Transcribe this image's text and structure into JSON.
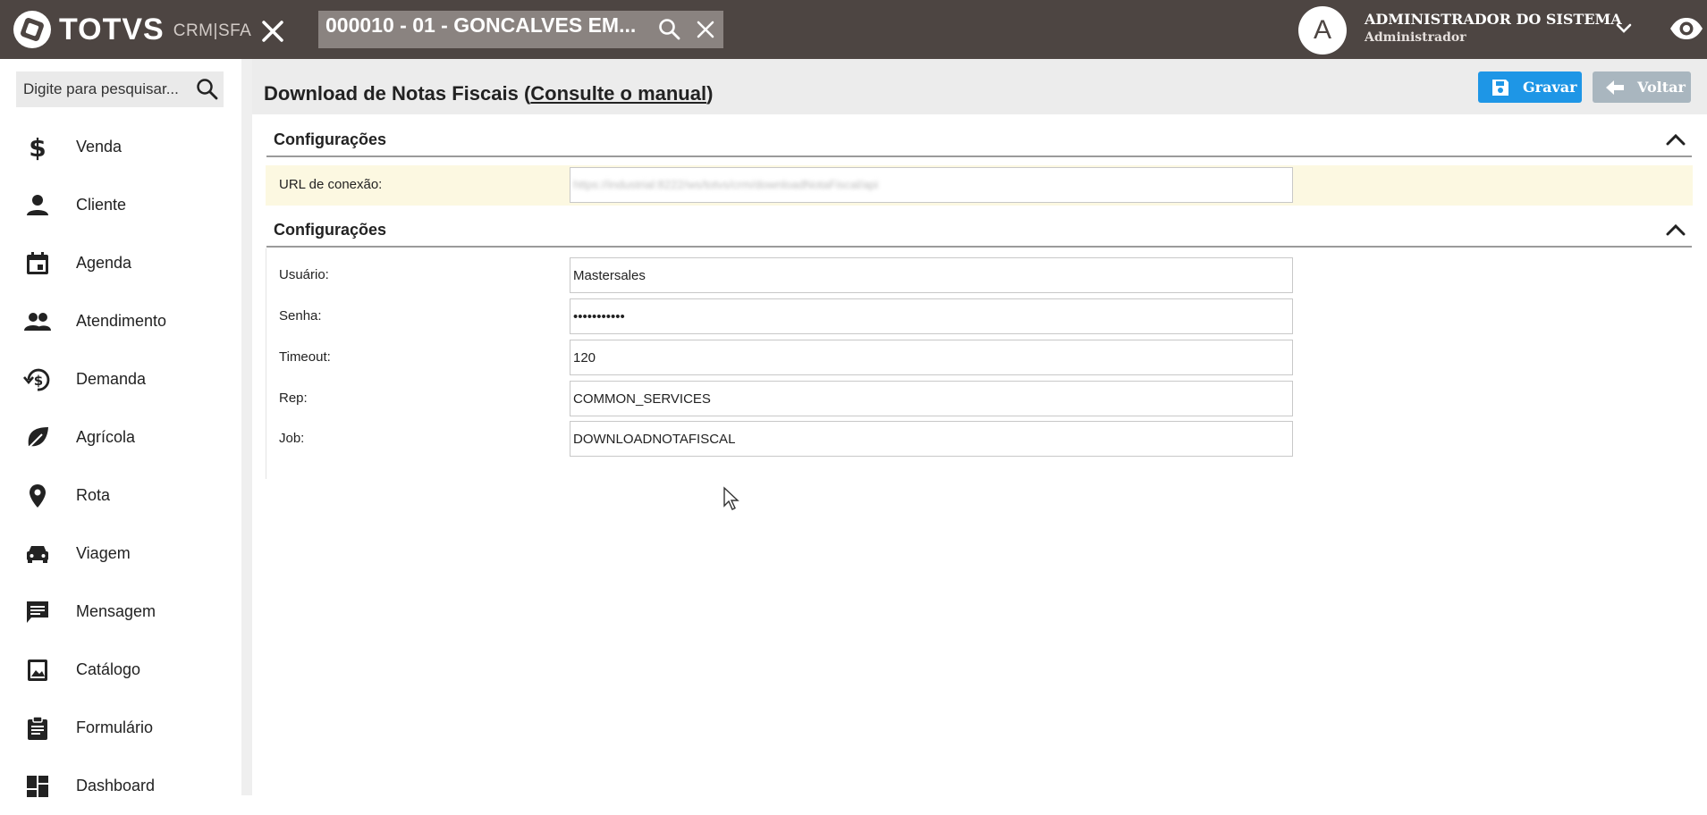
{
  "header": {
    "logo_text": "TOTVS",
    "logo_sub": "CRM|SFA",
    "client_selector": "000010 - 01 - GONCALVES EM...",
    "user_initial": "A",
    "user_name": "ADMINISTRADOR DO SISTEMA",
    "user_role": "Administrador"
  },
  "sidebar": {
    "search_placeholder": "Digite para pesquisar...",
    "items": [
      {
        "label": "Venda",
        "icon": "dollar-icon"
      },
      {
        "label": "Cliente",
        "icon": "person-icon"
      },
      {
        "label": "Agenda",
        "icon": "calendar-icon"
      },
      {
        "label": "Atendimento",
        "icon": "people-icon"
      },
      {
        "label": "Demanda",
        "icon": "history-dollar-icon"
      },
      {
        "label": "Agrícola",
        "icon": "leaf-icon"
      },
      {
        "label": "Rota",
        "icon": "pin-icon"
      },
      {
        "label": "Viagem",
        "icon": "car-icon"
      },
      {
        "label": "Mensagem",
        "icon": "message-icon"
      },
      {
        "label": "Catálogo",
        "icon": "image-icon"
      },
      {
        "label": "Formulário",
        "icon": "clipboard-icon"
      },
      {
        "label": "Dashboard",
        "icon": "dashboard-icon"
      }
    ]
  },
  "page": {
    "title": "Download de Notas Fiscais",
    "manual_open": "(",
    "manual_link": "Consulte o manual",
    "manual_close": ")",
    "save_label": "Gravar",
    "back_label": "Voltar"
  },
  "section1": {
    "title": "Configurações",
    "url_label": "URL de conexão:",
    "url_value": "https://industrial:8222/ws/totvs/crm/downloadNotaFiscal/api"
  },
  "section2": {
    "title": "Configurações",
    "fields": [
      {
        "label": "Usuário:",
        "value": "Mastersales"
      },
      {
        "label": "Senha:",
        "value": "•••••••••••"
      },
      {
        "label": "Timeout:",
        "value": "120"
      },
      {
        "label": "Rep:",
        "value": "COMMON_SERVICES"
      },
      {
        "label": "Job:",
        "value": "DOWNLOADNOTAFISCAL"
      }
    ]
  },
  "colors": {
    "topbar": "#4d4542",
    "primary_button": "#1e96e6",
    "secondary_button": "#a9b6bf",
    "highlight_row": "#fcf8e1"
  }
}
